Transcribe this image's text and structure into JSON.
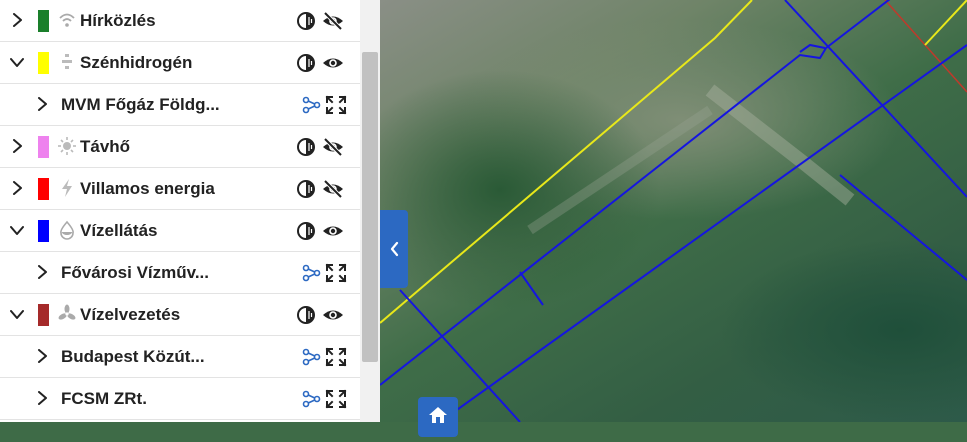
{
  "layers": [
    {
      "label": "Hírközlés",
      "level": 1,
      "expanded": false,
      "color": "#1a7f2b",
      "icon": "wifi-icon",
      "visible": false
    },
    {
      "label": "Szénhidrogén",
      "level": 1,
      "expanded": true,
      "color": "#ffff00",
      "icon": "gas-icon",
      "visible": true
    },
    {
      "label": "MVM Főgáz Földg...",
      "level": 2,
      "expanded": false
    },
    {
      "label": "Távhő",
      "level": 1,
      "expanded": false,
      "color": "#ee82ee",
      "icon": "sun-icon",
      "visible": false
    },
    {
      "label": "Villamos energia",
      "level": 1,
      "expanded": false,
      "color": "#ff0000",
      "icon": "bolt-icon",
      "visible": false
    },
    {
      "label": "Vízellátás",
      "level": 1,
      "expanded": true,
      "color": "#0000ff",
      "icon": "drop-icon",
      "visible": true
    },
    {
      "label": "Fővárosi Vízműv...",
      "level": 2,
      "expanded": false
    },
    {
      "label": "Vízelvezetés",
      "level": 1,
      "expanded": true,
      "color": "#a52a2a",
      "icon": "fan-icon",
      "visible": true
    },
    {
      "label": "Budapest Közút...",
      "level": 2,
      "expanded": false
    },
    {
      "label": "FCSM ZRt.",
      "level": 2,
      "expanded": false
    }
  ],
  "colors": {
    "accent": "#2c69c2",
    "network_line": "#0000ff",
    "gas_line": "#ffff00",
    "property_line": "#c0392b"
  }
}
